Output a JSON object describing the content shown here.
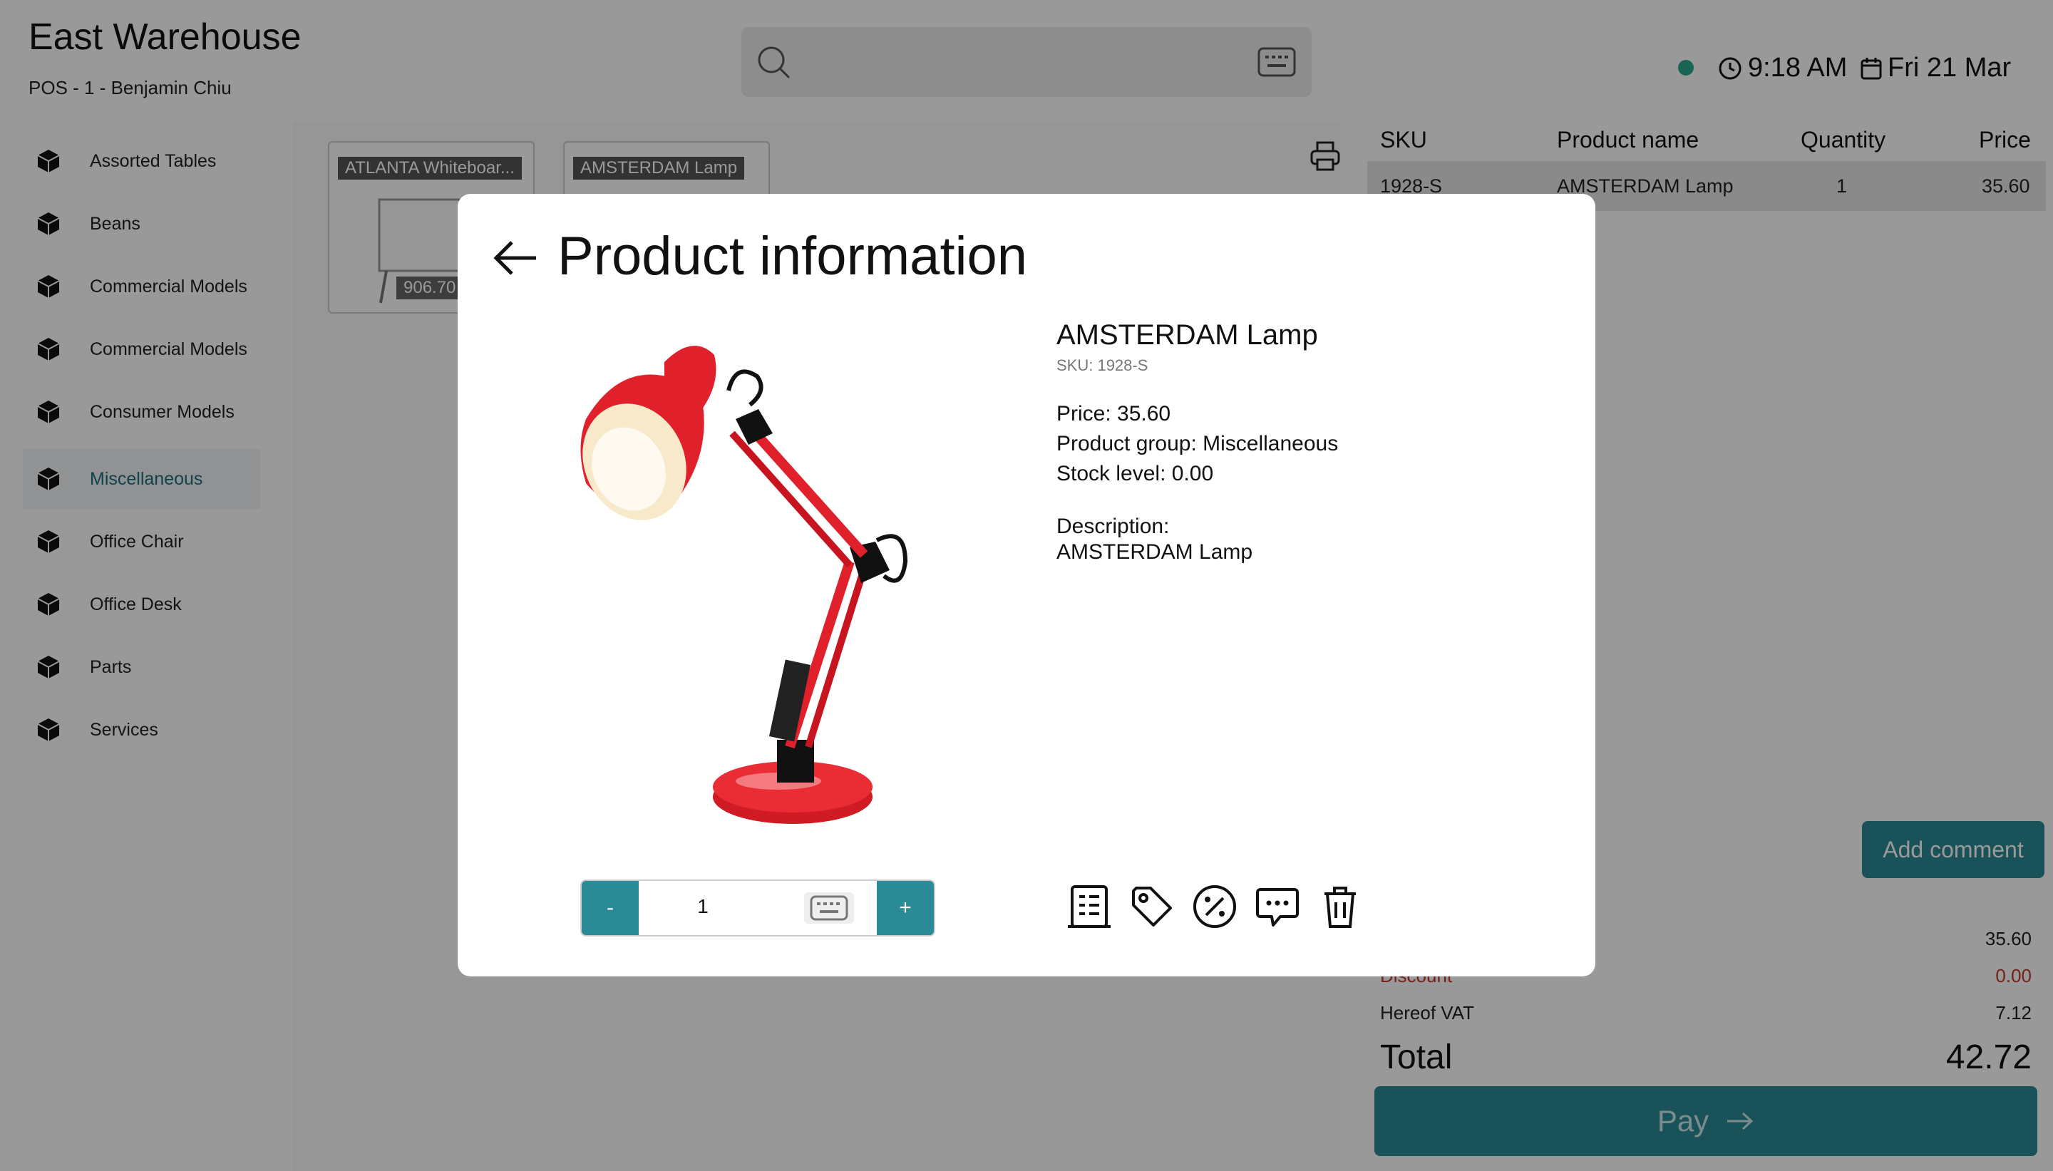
{
  "header": {
    "store_name": "East Warehouse",
    "pos_info": "POS - 1 - Benjamin Chiu",
    "time": "9:18 AM",
    "date": "Fri 21 Mar",
    "status_color": "#2aa98a"
  },
  "search": {
    "placeholder": "",
    "icon": "search-icon",
    "keyboard_icon": "keyboard-icon"
  },
  "sidebar": {
    "items": [
      {
        "label": "Assorted Tables"
      },
      {
        "label": "Beans"
      },
      {
        "label": "Commercial Models"
      },
      {
        "label": "Commercial Models"
      },
      {
        "label": "Consumer Models"
      },
      {
        "label": "Miscellaneous"
      },
      {
        "label": "Office Chair"
      },
      {
        "label": "Office Desk"
      },
      {
        "label": "Parts"
      },
      {
        "label": "Services"
      }
    ],
    "active_index": 5
  },
  "products": [
    {
      "name": "ATLANTA Whiteboar...",
      "price": "906.70"
    },
    {
      "name": "AMSTERDAM Lamp",
      "price": ""
    }
  ],
  "cart": {
    "columns": [
      "SKU",
      "Product name",
      "Quantity",
      "Price"
    ],
    "rows": [
      {
        "sku": "1928-S",
        "name": "AMSTERDAM Lamp",
        "qty": "1",
        "price": "35.60"
      }
    ],
    "add_comment_label": "Add comment",
    "subtotal_value": "35.60",
    "discount_label": "Discount",
    "discount_value": "0.00",
    "vat_label": "Hereof VAT",
    "vat_value": "7.12",
    "total_label": "Total",
    "total_value": "42.72",
    "pay_label": "Pay"
  },
  "modal": {
    "title": "Product information",
    "product_name": "AMSTERDAM Lamp",
    "sku_line": "SKU: 1928-S",
    "price_line": "Price: 35.60",
    "group_line": "Product group: Miscellaneous",
    "stock_line": "Stock level: 0.00",
    "description_label": "Description:",
    "description_text": "AMSTERDAM Lamp",
    "quantity_value": "1",
    "minus_label": "-",
    "plus_label": "+",
    "actions": [
      "details-icon",
      "tag-icon",
      "discount-icon",
      "comment-icon",
      "trash-icon"
    ]
  },
  "colors": {
    "accent": "#2a8a95",
    "discount_red": "#c0392b",
    "lamp_red": "#e0202a"
  }
}
